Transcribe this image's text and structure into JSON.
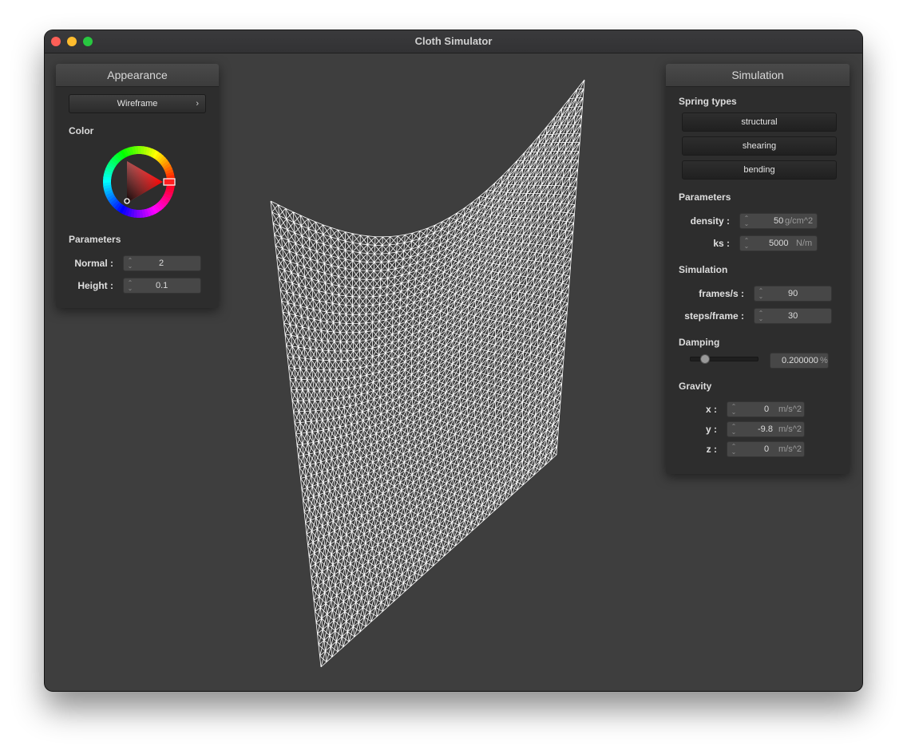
{
  "window": {
    "title": "Cloth Simulator"
  },
  "appearance": {
    "title": "Appearance",
    "mode": "Wireframe",
    "color_label": "Color",
    "selected_color": "#ff0000",
    "params_label": "Parameters",
    "normal": {
      "label": "Normal :",
      "value": "2"
    },
    "height": {
      "label": "Height :",
      "value": "0.1"
    }
  },
  "simulation": {
    "title": "Simulation",
    "spring_types_label": "Spring types",
    "spring_buttons": [
      "structural",
      "shearing",
      "bending"
    ],
    "params_label": "Parameters",
    "density": {
      "label": "density :",
      "value": "50",
      "unit": "g/cm^2"
    },
    "ks": {
      "label": "ks :",
      "value": "5000",
      "unit": "N/m"
    },
    "sim_label": "Simulation",
    "fps": {
      "label": "frames/s :",
      "value": "90"
    },
    "steps": {
      "label": "steps/frame :",
      "value": "30"
    },
    "damping_label": "Damping",
    "damping": {
      "value": "0.200000",
      "unit": "%",
      "slider_fraction": 0.2
    },
    "gravity_label": "Gravity",
    "gx": {
      "label": "x :",
      "value": "0",
      "unit": "m/s^2"
    },
    "gy": {
      "label": "y :",
      "value": "-9.8",
      "unit": "m/s^2"
    },
    "gz": {
      "label": "z :",
      "value": "0",
      "unit": "m/s^2"
    }
  },
  "colors": {
    "background": "#3e3e3e",
    "cloth": "#ffffff",
    "panel": "#2d2d2d"
  }
}
